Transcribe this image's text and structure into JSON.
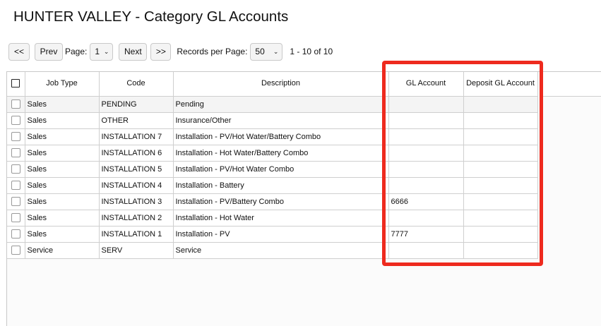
{
  "page": {
    "title": "HUNTER VALLEY - Category GL Accounts"
  },
  "pager": {
    "first_label": "<<",
    "prev_label": "Prev",
    "page_label": "Page:",
    "page_value": "1",
    "next_label": "Next",
    "last_label": ">>",
    "rpp_label": "Records per Page:",
    "rpp_value": "50",
    "range_text": "1 - 10 of 10"
  },
  "columns": {
    "job_type": "Job Type",
    "code": "Code",
    "description": "Description",
    "gl_account": "GL Account",
    "deposit_gl_account": "Deposit GL Account"
  },
  "rows": [
    {
      "job_type": "Sales",
      "code": "PENDING",
      "description": "Pending",
      "gl_account": "",
      "deposit_gl_account": ""
    },
    {
      "job_type": "Sales",
      "code": "OTHER",
      "description": "Insurance/Other",
      "gl_account": "",
      "deposit_gl_account": ""
    },
    {
      "job_type": "Sales",
      "code": "INSTALLATION 7",
      "description": "Installation - PV/Hot Water/Battery Combo",
      "gl_account": "",
      "deposit_gl_account": ""
    },
    {
      "job_type": "Sales",
      "code": "INSTALLATION 6",
      "description": "Installation - Hot Water/Battery Combo",
      "gl_account": "",
      "deposit_gl_account": ""
    },
    {
      "job_type": "Sales",
      "code": "INSTALLATION 5",
      "description": "Installation - PV/Hot Water Combo",
      "gl_account": "",
      "deposit_gl_account": ""
    },
    {
      "job_type": "Sales",
      "code": "INSTALLATION 4",
      "description": "Installation - Battery",
      "gl_account": "",
      "deposit_gl_account": ""
    },
    {
      "job_type": "Sales",
      "code": "INSTALLATION 3",
      "description": "Installation - PV/Battery Combo",
      "gl_account": "6666",
      "deposit_gl_account": ""
    },
    {
      "job_type": "Sales",
      "code": "INSTALLATION 2",
      "description": "Installation - Hot Water",
      "gl_account": "",
      "deposit_gl_account": ""
    },
    {
      "job_type": "Sales",
      "code": "INSTALLATION 1",
      "description": "Installation - PV",
      "gl_account": "7777",
      "deposit_gl_account": ""
    },
    {
      "job_type": "Service",
      "code": "SERV",
      "description": "Service",
      "gl_account": "",
      "deposit_gl_account": ""
    }
  ],
  "highlight_color": "#ee2a1e"
}
